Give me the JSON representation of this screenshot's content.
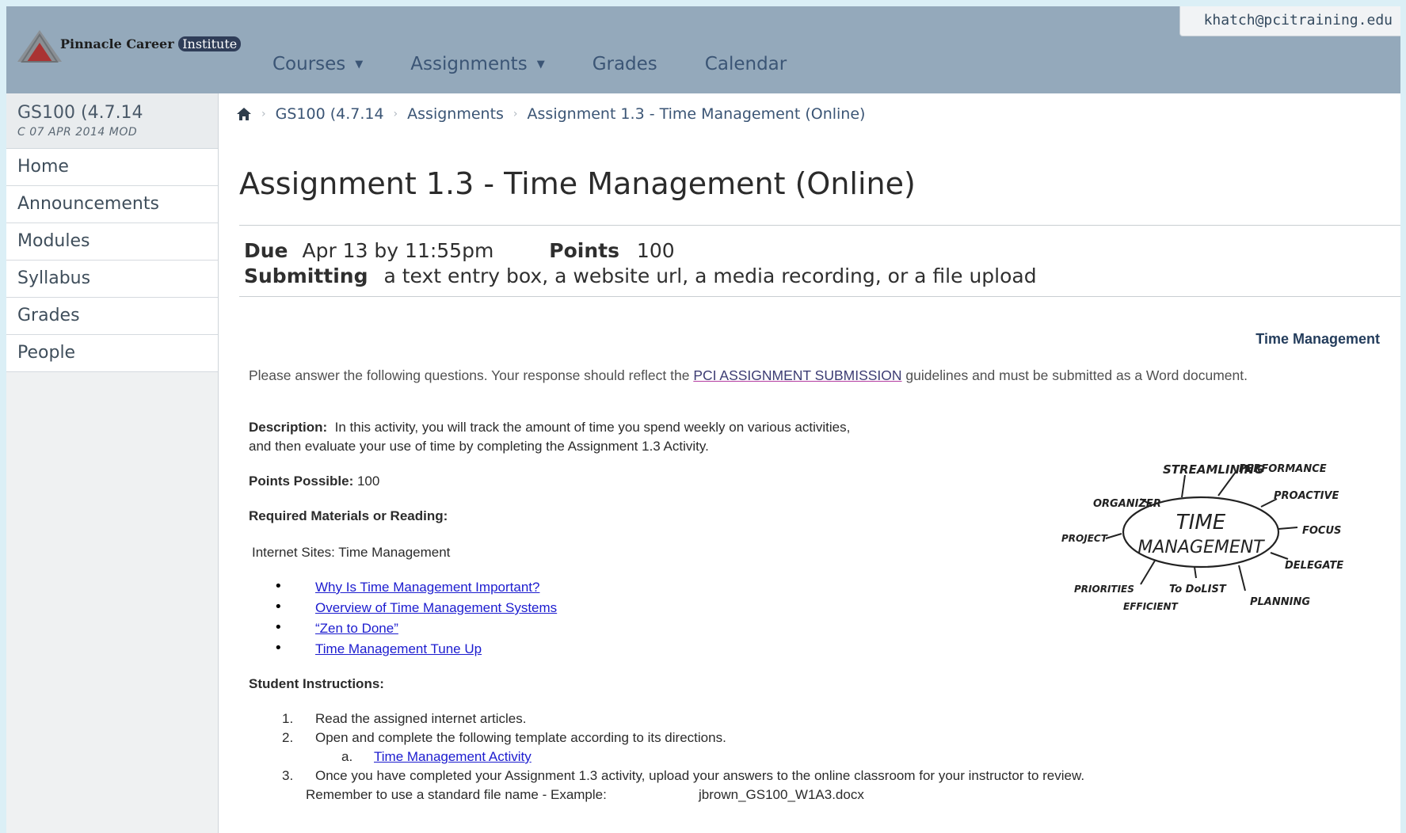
{
  "header": {
    "logo": {
      "brand": "Pinnacle Career",
      "brand_badge": "Institute"
    },
    "user_email": "khatch@pcitraining.edu",
    "nav": [
      {
        "label": "Courses",
        "has_dropdown": true
      },
      {
        "label": "Assignments",
        "has_dropdown": true
      },
      {
        "label": "Grades",
        "has_dropdown": false
      },
      {
        "label": "Calendar",
        "has_dropdown": false
      }
    ]
  },
  "sidebar": {
    "course_code": "GS100 (4.7.14",
    "course_sub": "C 07 APR 2014 MOD",
    "items": [
      {
        "label": "Home"
      },
      {
        "label": "Announcements"
      },
      {
        "label": "Modules"
      },
      {
        "label": "Syllabus"
      },
      {
        "label": "Grades"
      },
      {
        "label": "People"
      }
    ]
  },
  "breadcrumb": [
    {
      "label": "GS100 (4.7.14"
    },
    {
      "label": "Assignments"
    },
    {
      "label": "Assignment 1.3 - Time Management (Online)"
    }
  ],
  "assignment": {
    "title": "Assignment 1.3 - Time Management (Online)",
    "due_label": "Due",
    "due_value": "Apr 13 by 11:55pm",
    "points_label": "Points",
    "points_value": "100",
    "submitting_label": "Submitting",
    "submitting_value": "a text entry box, a website url, a media recording, or a file upload"
  },
  "content": {
    "section_title": "Time Management",
    "intro_before": "Please answer the following questions. Your response should reflect the ",
    "intro_link": "PCI ASSIGNMENT SUBMISSION",
    "intro_after": " guidelines and must be submitted as a Word document.",
    "description_label": "Description:",
    "description_line1": "  In this activity, you will track the amount of time you spend weekly on various activities,",
    "description_line2": "and then evaluate your use of time by completing the Assignment 1.3 Activity.",
    "points_possible_label": "Points Possible:",
    "points_possible_value": " 100",
    "required_label": "Required Materials or Reading:",
    "internet_sites": "Internet Sites: Time Management",
    "links": [
      "Why Is Time Management Important?",
      "Overview of Time Management Systems",
      "“Zen to Done”",
      "Time Management Tune Up"
    ],
    "instructions_label": "Student Instructions:",
    "steps": [
      {
        "num": "1.",
        "text": "Read the assigned internet articles."
      },
      {
        "num": "2.",
        "text": "Open and complete the following template according to its directions."
      },
      {
        "num": "3.",
        "text": "Once you have completed your Assignment 1.3 activity, upload your answers to the online classroom for your instructor to review."
      }
    ],
    "substep_letter": "a.",
    "substep_link": "Time Management Activity",
    "filename_note": "Remember to use a standard file name - Example:",
    "filename_example": "jbrown_GS100_W1A3.docx"
  },
  "graphic": {
    "center_top": "TIME",
    "center_bottom": "MANAGEMENT",
    "words": [
      "STREAMLINING",
      "PERFORMANCE",
      "ORGANIZER",
      "PROACTIVE",
      "PROJECT",
      "FOCUS",
      "DELEGATE",
      "PRIORITIES",
      "To DoLIST",
      "PLANNING",
      "EFFICIENT"
    ]
  },
  "colors": {
    "header_bg": "#94a9bb",
    "nav_text": "#3b5575",
    "link": "#1c1ccf",
    "page_bg": "#dbeff6"
  }
}
